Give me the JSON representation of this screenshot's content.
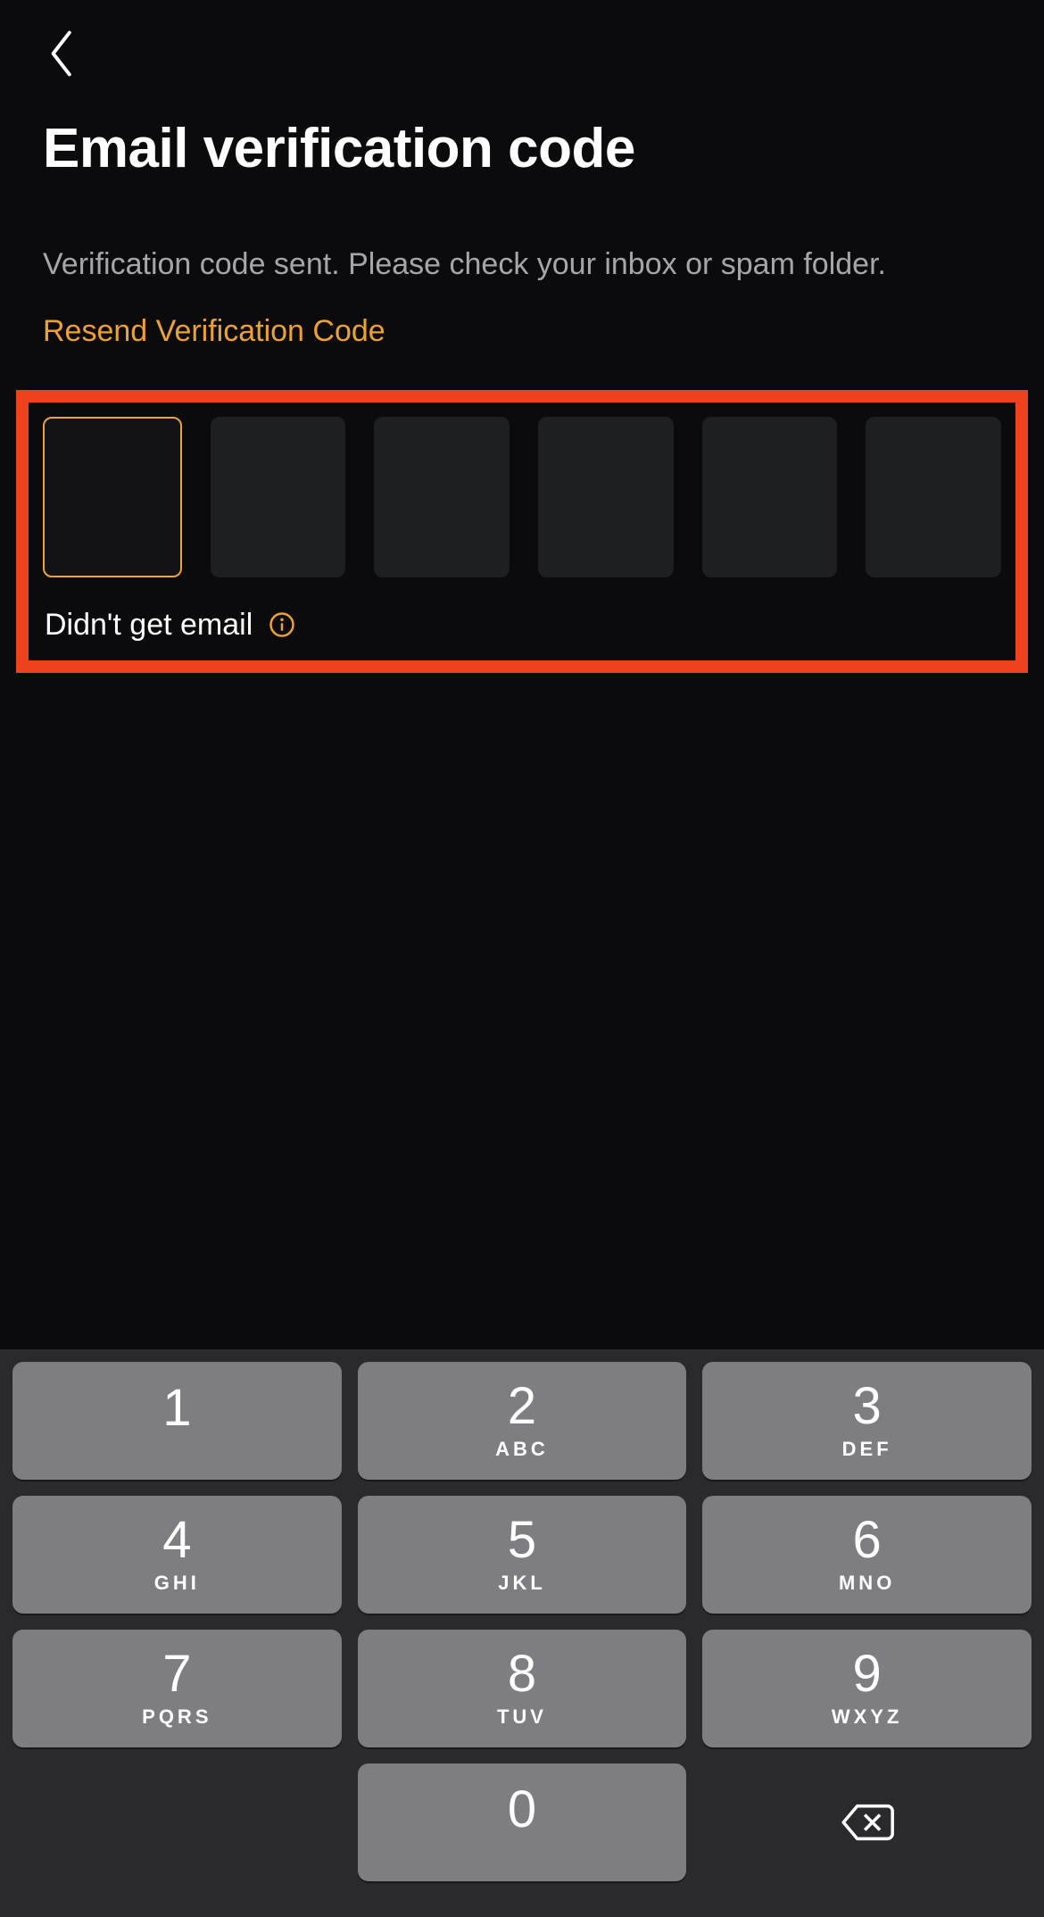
{
  "header": {
    "title": "Email verification code",
    "subtitle": "Verification code sent. Please check your inbox or spam folder.",
    "resend": "Resend Verification Code"
  },
  "code": {
    "digits": [
      "",
      "",
      "",
      "",
      "",
      ""
    ],
    "active_index": 0,
    "didnt_get": "Didn't get email"
  },
  "colors": {
    "accent": "#eca233",
    "highlight_border": "#ee421e",
    "background": "#0b0b0e",
    "box": "#1e1f23"
  },
  "keypad": {
    "keys": [
      {
        "digit": "1",
        "letters": ""
      },
      {
        "digit": "2",
        "letters": "ABC"
      },
      {
        "digit": "3",
        "letters": "DEF"
      },
      {
        "digit": "4",
        "letters": "GHI"
      },
      {
        "digit": "5",
        "letters": "JKL"
      },
      {
        "digit": "6",
        "letters": "MNO"
      },
      {
        "digit": "7",
        "letters": "PQRS"
      },
      {
        "digit": "8",
        "letters": "TUV"
      },
      {
        "digit": "9",
        "letters": "WXYZ"
      },
      {
        "digit": "",
        "letters": "",
        "blank": true
      },
      {
        "digit": "0",
        "letters": ""
      },
      {
        "digit": "",
        "letters": "",
        "backspace": true
      }
    ]
  }
}
